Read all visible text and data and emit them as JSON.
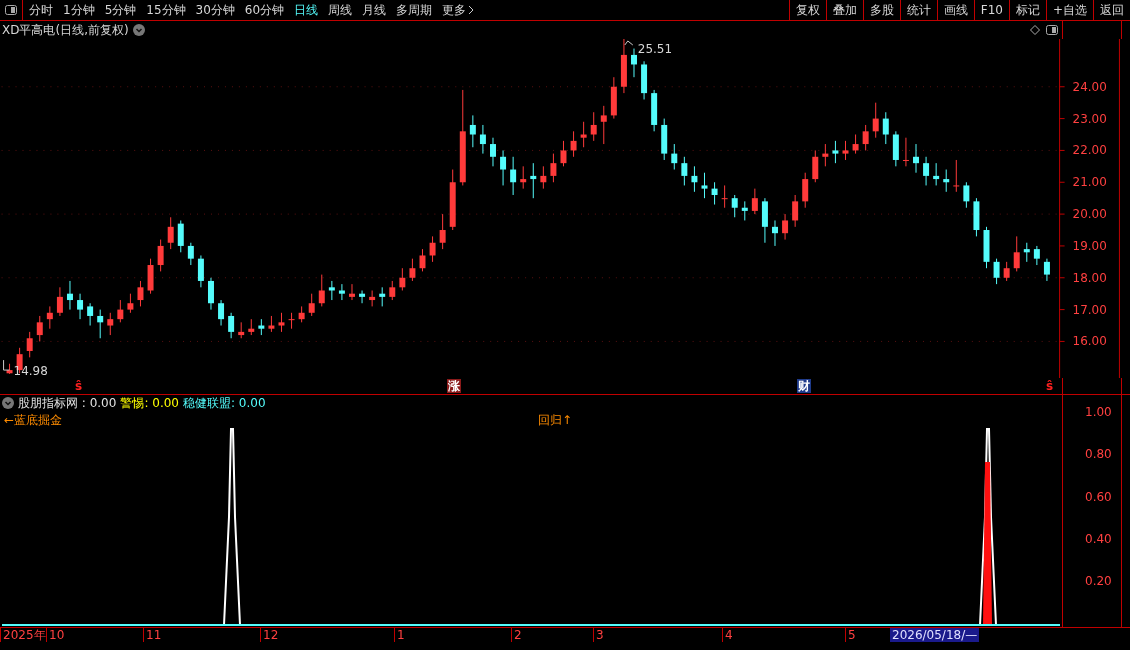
{
  "toolbar": {
    "periods": [
      {
        "label": "分时",
        "selected": false
      },
      {
        "label": "1分钟",
        "selected": false
      },
      {
        "label": "5分钟",
        "selected": false
      },
      {
        "label": "15分钟",
        "selected": false
      },
      {
        "label": "30分钟",
        "selected": false
      },
      {
        "label": "60分钟",
        "selected": false
      },
      {
        "label": "日线",
        "selected": true
      },
      {
        "label": "周线",
        "selected": false
      },
      {
        "label": "月线",
        "selected": false
      },
      {
        "label": "多周期",
        "selected": false
      },
      {
        "label": "更多",
        "selected": false
      }
    ],
    "actions": [
      "复权",
      "叠加",
      "多股",
      "统计",
      "画线",
      "F10",
      "标记",
      "+自选",
      "返回"
    ]
  },
  "main_chart": {
    "title": "XD平高电(日线,前复权)",
    "high_label": "25.51",
    "low_label": "14.98",
    "chart_data": {
      "type": "candlestick",
      "ylim": [
        14.85,
        25.5
      ],
      "grid": true,
      "yticks": [
        {
          "value": 24,
          "label": "24.00"
        },
        {
          "value": 23,
          "label": "23.00"
        },
        {
          "value": 22,
          "label": "22.00"
        },
        {
          "value": 21,
          "label": "21.00"
        },
        {
          "value": 20,
          "label": "20.00"
        },
        {
          "value": 19,
          "label": "19.00"
        },
        {
          "value": 18,
          "label": "18.00"
        },
        {
          "value": 17,
          "label": "17.00"
        },
        {
          "value": 16,
          "label": "16.00"
        }
      ],
      "ohlc": [
        [
          15.0,
          15.3,
          14.98,
          15.1
        ],
        [
          15.1,
          15.8,
          15.0,
          15.6
        ],
        [
          15.7,
          16.3,
          15.5,
          16.1
        ],
        [
          16.2,
          16.8,
          16.0,
          16.6
        ],
        [
          16.7,
          17.1,
          16.4,
          16.9
        ],
        [
          16.9,
          17.7,
          16.8,
          17.4
        ],
        [
          17.5,
          17.9,
          17.0,
          17.3
        ],
        [
          17.3,
          17.5,
          16.7,
          17.0
        ],
        [
          17.1,
          17.2,
          16.5,
          16.8
        ],
        [
          16.8,
          17.0,
          16.1,
          16.6
        ],
        [
          16.5,
          16.9,
          16.2,
          16.7
        ],
        [
          16.7,
          17.3,
          16.6,
          17.0
        ],
        [
          17.0,
          17.5,
          16.9,
          17.2
        ],
        [
          17.3,
          17.9,
          17.1,
          17.7
        ],
        [
          17.6,
          18.6,
          17.5,
          18.4
        ],
        [
          18.4,
          19.2,
          18.2,
          19.0
        ],
        [
          19.1,
          19.9,
          18.9,
          19.6
        ],
        [
          19.7,
          19.8,
          18.8,
          19.0
        ],
        [
          19.0,
          19.1,
          18.4,
          18.6
        ],
        [
          18.6,
          18.7,
          17.7,
          17.9
        ],
        [
          17.9,
          18.0,
          17.0,
          17.2
        ],
        [
          17.2,
          17.3,
          16.5,
          16.7
        ],
        [
          16.8,
          16.9,
          16.1,
          16.3
        ],
        [
          16.2,
          16.6,
          16.1,
          16.3
        ],
        [
          16.3,
          16.7,
          16.2,
          16.4
        ],
        [
          16.5,
          16.7,
          16.2,
          16.4
        ],
        [
          16.4,
          16.8,
          16.3,
          16.5
        ],
        [
          16.5,
          16.9,
          16.3,
          16.6
        ],
        [
          16.7,
          16.9,
          16.4,
          16.7
        ],
        [
          16.7,
          17.1,
          16.6,
          16.9
        ],
        [
          16.9,
          17.5,
          16.8,
          17.2
        ],
        [
          17.2,
          18.1,
          17.1,
          17.6
        ],
        [
          17.7,
          17.9,
          17.3,
          17.6
        ],
        [
          17.6,
          17.8,
          17.3,
          17.5
        ],
        [
          17.4,
          17.8,
          17.3,
          17.5
        ],
        [
          17.5,
          17.6,
          17.2,
          17.4
        ],
        [
          17.3,
          17.6,
          17.1,
          17.4
        ],
        [
          17.5,
          17.7,
          17.1,
          17.4
        ],
        [
          17.4,
          17.9,
          17.3,
          17.7
        ],
        [
          17.7,
          18.3,
          17.6,
          18.0
        ],
        [
          18.0,
          18.6,
          17.9,
          18.3
        ],
        [
          18.3,
          18.9,
          18.2,
          18.7
        ],
        [
          18.7,
          19.3,
          18.5,
          19.1
        ],
        [
          19.1,
          20.0,
          18.9,
          19.5
        ],
        [
          19.6,
          21.4,
          19.5,
          21.0
        ],
        [
          21.0,
          23.9,
          20.9,
          22.6
        ],
        [
          22.8,
          23.1,
          22.1,
          22.5
        ],
        [
          22.5,
          22.8,
          21.9,
          22.2
        ],
        [
          22.2,
          22.4,
          21.5,
          21.8
        ],
        [
          21.8,
          22.0,
          20.9,
          21.4
        ],
        [
          21.4,
          21.8,
          20.6,
          21.0
        ],
        [
          21.0,
          21.5,
          20.8,
          21.1
        ],
        [
          21.2,
          21.6,
          20.5,
          21.1
        ],
        [
          21.0,
          21.5,
          20.8,
          21.2
        ],
        [
          21.2,
          21.9,
          21.0,
          21.6
        ],
        [
          21.6,
          22.3,
          21.5,
          22.0
        ],
        [
          22.0,
          22.6,
          21.8,
          22.3
        ],
        [
          22.4,
          22.9,
          22.1,
          22.5
        ],
        [
          22.5,
          23.2,
          22.3,
          22.8
        ],
        [
          22.9,
          23.4,
          22.2,
          23.1
        ],
        [
          23.1,
          24.3,
          23.0,
          24.0
        ],
        [
          24.0,
          25.51,
          23.8,
          25.0
        ],
        [
          25.0,
          25.2,
          24.3,
          24.7
        ],
        [
          24.7,
          24.8,
          23.6,
          23.8
        ],
        [
          23.8,
          23.9,
          22.6,
          22.8
        ],
        [
          22.8,
          23.0,
          21.7,
          21.9
        ],
        [
          21.9,
          22.2,
          21.4,
          21.6
        ],
        [
          21.6,
          21.8,
          20.9,
          21.2
        ],
        [
          21.2,
          21.5,
          20.7,
          21.0
        ],
        [
          20.9,
          21.3,
          20.5,
          20.8
        ],
        [
          20.8,
          21.0,
          20.3,
          20.6
        ],
        [
          20.5,
          20.9,
          20.2,
          20.5
        ],
        [
          20.5,
          20.6,
          19.9,
          20.2
        ],
        [
          20.2,
          20.4,
          19.8,
          20.1
        ],
        [
          20.1,
          20.8,
          20.0,
          20.5
        ],
        [
          20.4,
          20.5,
          19.1,
          19.6
        ],
        [
          19.6,
          19.8,
          19.0,
          19.4
        ],
        [
          19.4,
          20.0,
          19.2,
          19.8
        ],
        [
          19.8,
          20.6,
          19.6,
          20.4
        ],
        [
          20.4,
          21.3,
          20.2,
          21.1
        ],
        [
          21.1,
          22.0,
          21.0,
          21.8
        ],
        [
          21.8,
          22.2,
          21.5,
          21.9
        ],
        [
          22.0,
          22.3,
          21.6,
          21.9
        ],
        [
          21.9,
          22.3,
          21.7,
          22.0
        ],
        [
          22.0,
          22.5,
          21.9,
          22.2
        ],
        [
          22.2,
          22.8,
          22.0,
          22.6
        ],
        [
          22.6,
          23.5,
          22.4,
          23.0
        ],
        [
          23.0,
          23.2,
          22.2,
          22.5
        ],
        [
          22.5,
          22.6,
          21.5,
          21.7
        ],
        [
          21.7,
          22.4,
          21.5,
          21.7
        ],
        [
          21.8,
          22.2,
          21.3,
          21.6
        ],
        [
          21.6,
          21.8,
          20.9,
          21.2
        ],
        [
          21.2,
          21.6,
          20.9,
          21.1
        ],
        [
          21.1,
          21.4,
          20.7,
          21.0
        ],
        [
          20.9,
          21.7,
          20.7,
          20.9
        ],
        [
          20.9,
          21.0,
          20.2,
          20.4
        ],
        [
          20.4,
          20.5,
          19.3,
          19.5
        ],
        [
          19.5,
          19.6,
          18.3,
          18.5
        ],
        [
          18.5,
          18.6,
          17.8,
          18.0
        ],
        [
          18.0,
          18.5,
          17.9,
          18.3
        ],
        [
          18.3,
          19.3,
          18.2,
          18.8
        ],
        [
          18.9,
          19.1,
          18.5,
          18.8
        ],
        [
          18.9,
          19.0,
          18.4,
          18.6
        ],
        [
          18.5,
          18.6,
          17.9,
          18.1
        ]
      ]
    },
    "markers": [
      {
        "kind": "signal",
        "label": "ŝ",
        "color": "#ff2020"
      },
      {
        "kind": "tag",
        "label": "涨",
        "color": "#8b1a1a"
      },
      {
        "kind": "tag",
        "label": "财",
        "color": "#1e3a8a"
      },
      {
        "kind": "signal",
        "label": "ŝ",
        "color": "#ff2020"
      }
    ]
  },
  "indicator": {
    "readouts": [
      {
        "label": "股朋指标网 : 0.00",
        "color": "#e0e0e0"
      },
      {
        "label": "警惕: 0.00",
        "color": "#ffff00"
      },
      {
        "label": "稳健联盟: 0.00",
        "color": "#54fcfc"
      }
    ],
    "notes": [
      "←蓝底掘金",
      "回归↑"
    ],
    "axis": [
      "1.00",
      "0.80",
      "0.60",
      "0.40",
      "0.20"
    ]
  },
  "time_axis": {
    "labels": [
      "2025年",
      "10",
      "11",
      "12",
      "1",
      "2",
      "3",
      "4",
      "5"
    ],
    "cursor_date": "2026/05/18/—"
  }
}
